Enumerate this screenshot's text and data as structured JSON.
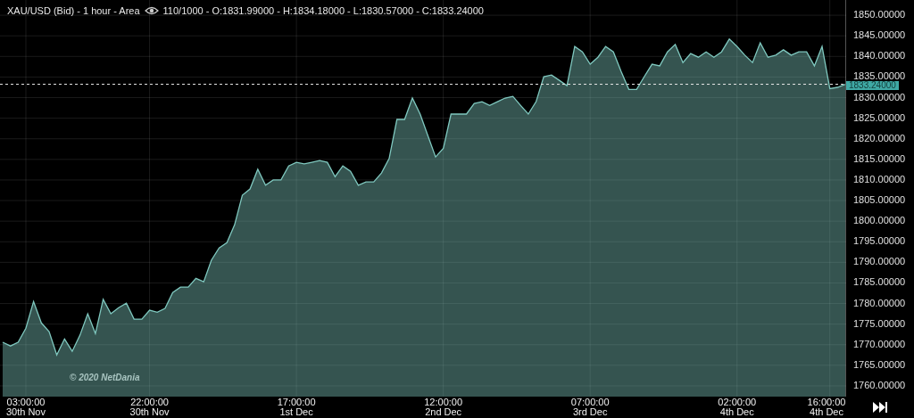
{
  "header": {
    "title": "XAU/USD (Bid) - 1 hour - Area",
    "stats": "110/1000 - O:1831.99000 - H:1834.18000 - L:1830.57000 - C:1833.24000"
  },
  "credit": "© 2020 NetDania",
  "chart_data": {
    "type": "area",
    "categories": [
      null,
      null,
      null,
      "03:00:00\n30th Nov",
      null,
      null,
      null,
      null,
      null,
      null,
      null,
      null,
      null,
      null,
      null,
      null,
      null,
      null,
      null,
      "22:00:00\n30th Nov",
      null,
      null,
      null,
      null,
      null,
      null,
      null,
      null,
      null,
      null,
      null,
      null,
      null,
      null,
      null,
      null,
      null,
      null,
      "17:00:00\n1st Dec",
      null,
      null,
      null,
      null,
      null,
      null,
      null,
      null,
      null,
      null,
      null,
      null,
      null,
      null,
      null,
      null,
      null,
      null,
      "12:00:00\n2nd Dec",
      null,
      null,
      null,
      null,
      null,
      null,
      null,
      null,
      null,
      null,
      null,
      null,
      null,
      null,
      null,
      null,
      null,
      null,
      "07:00:00\n3rd Dec",
      null,
      null,
      null,
      null,
      null,
      null,
      null,
      null,
      null,
      null,
      null,
      null,
      null,
      null,
      null,
      null,
      null,
      null,
      "02:00:00\n4th Dec",
      null,
      null,
      null,
      null,
      null,
      null,
      null,
      null,
      null,
      null,
      null,
      "16:00:00\n4th Dec",
      null,
      null
    ],
    "series": [
      {
        "color": "#7fc8bf",
        "values": [
          1770.6,
          1769.7,
          1770.6,
          1774.0,
          1780.5,
          1775.3,
          1773.2,
          1767.5,
          1771.4,
          1768.4,
          1772.3,
          1777.5,
          1772.7,
          1781.0,
          1777.5,
          1779.0,
          1780.1,
          1776.2,
          1776.2,
          1778.4,
          1777.9,
          1778.8,
          1782.7,
          1784.0,
          1784.0,
          1786.1,
          1785.3,
          1790.5,
          1793.5,
          1794.8,
          1799.1,
          1806.3,
          1807.8,
          1812.6,
          1808.7,
          1810.0,
          1810.0,
          1813.4,
          1814.3,
          1813.9,
          1814.3,
          1814.7,
          1814.3,
          1810.8,
          1813.4,
          1812.1,
          1808.7,
          1809.5,
          1809.5,
          1811.7,
          1815.2,
          1824.7,
          1824.7,
          1829.9,
          1826.0,
          1820.8,
          1815.6,
          1817.7,
          1826.0,
          1826.0,
          1826.0,
          1828.6,
          1829.0,
          1828.1,
          1829.0,
          1829.9,
          1830.3,
          1828.1,
          1826.0,
          1829.0,
          1835.1,
          1835.5,
          1834.2,
          1832.9,
          1842.4,
          1841.1,
          1838.1,
          1839.8,
          1842.4,
          1841.1,
          1836.4,
          1832.0,
          1832.0,
          1835.1,
          1838.1,
          1837.7,
          1841.1,
          1842.9,
          1838.5,
          1840.7,
          1839.8,
          1841.1,
          1839.8,
          1841.1,
          1844.2,
          1842.4,
          1840.3,
          1838.5,
          1843.3,
          1839.8,
          1840.3,
          1841.6,
          1840.3,
          1841.1,
          1841.1,
          1837.7,
          1842.4,
          1832.2,
          1832.5,
          1833.2
        ]
      }
    ],
    "ylim": [
      1757.4,
      1853.7
    ],
    "yticks": [
      {
        "value": 1760,
        "label": "1760.00000"
      },
      {
        "value": 1765,
        "label": "1765.00000"
      },
      {
        "value": 1770,
        "label": "1770.00000"
      },
      {
        "value": 1775,
        "label": "1775.00000"
      },
      {
        "value": 1780,
        "label": "1780.00000"
      },
      {
        "value": 1785,
        "label": "1785.00000"
      },
      {
        "value": 1790,
        "label": "1790.00000"
      },
      {
        "value": 1795,
        "label": "1795.00000"
      },
      {
        "value": 1800,
        "label": "1800.00000"
      },
      {
        "value": 1805,
        "label": "1805.00000"
      },
      {
        "value": 1810,
        "label": "1810.00000"
      },
      {
        "value": 1815,
        "label": "1815.00000"
      },
      {
        "value": 1820,
        "label": "1820.00000"
      },
      {
        "value": 1825,
        "label": "1825.00000"
      },
      {
        "value": 1830,
        "label": "1830.00000"
      },
      {
        "value": 1835,
        "label": "1835.00000"
      },
      {
        "value": 1840,
        "label": "1840.00000"
      },
      {
        "value": 1845,
        "label": "1845.00000"
      },
      {
        "value": 1850,
        "label": "1850.00000"
      }
    ],
    "grid": true,
    "ref_lines": [
      {
        "axis": "y",
        "value": 1833.24,
        "label": "1833.24000"
      }
    ]
  }
}
